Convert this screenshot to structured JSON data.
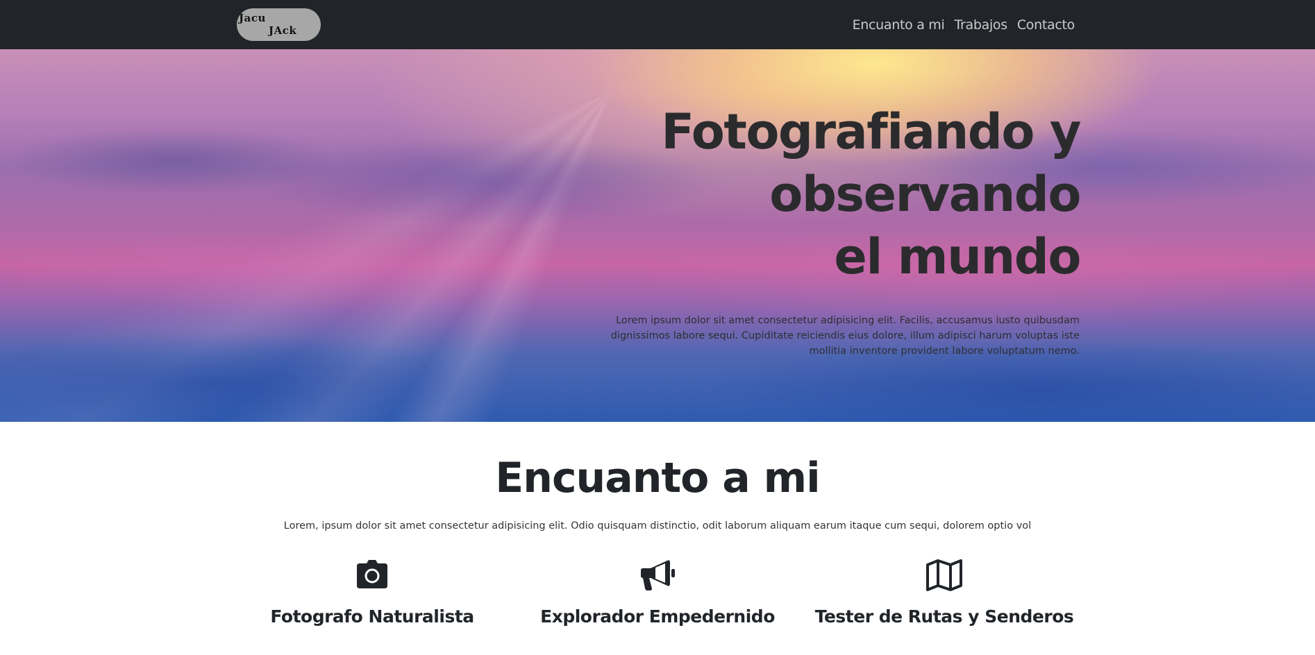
{
  "navbar": {
    "logo_line1": "Jacu",
    "logo_line2": "JAck",
    "links": [
      "Encuanto a mi",
      "Trabajos",
      "Contacto"
    ],
    "background": "#212529"
  },
  "hero": {
    "title_lines": [
      "Fotografiando y",
      "observando",
      "el mundo"
    ],
    "text": "Lorem ipsum dolor sit amet consectetur adipisicing elit. Facilis, accusamus iusto quibusdam dignissimos labore sequi. Cupiditate reiciendis eius dolore, illum adipisci harum voluptas iste mollitia inventore provident labore voluptatum nemo."
  },
  "about": {
    "title": "Encuanto a mi",
    "text": "Lorem, ipsum dolor sit amet consectetur adipisicing elit. Odio quisquam distinctio, odit laborum aliquam earum itaque cum sequi, dolorem optio vol",
    "features": [
      {
        "icon": "camera-icon",
        "title": "Fotografo Naturalista"
      },
      {
        "icon": "megaphone-icon",
        "title": "Explorador Empedernido"
      },
      {
        "icon": "map-icon",
        "title": "Tester de Rutas y Senderos"
      }
    ]
  },
  "colors": {
    "text_dark": "#212529",
    "nav_link": "#c9cbcd",
    "logo_bg": "#a7a7a7"
  }
}
